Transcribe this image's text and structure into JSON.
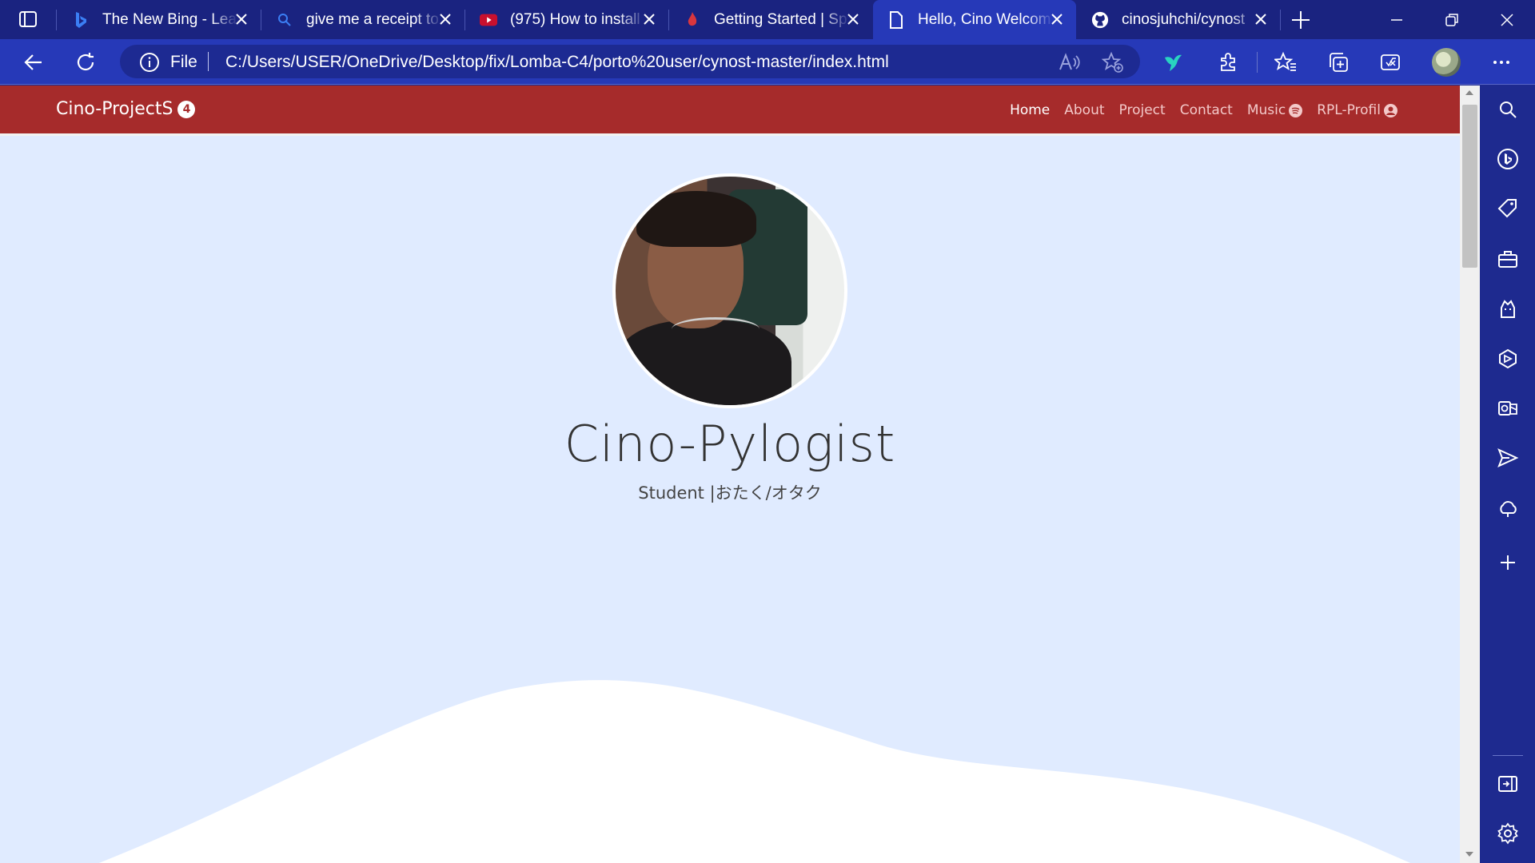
{
  "browser": {
    "tabs": [
      {
        "title": "The New Bing - Lear",
        "icon": "bing-icon",
        "active": false
      },
      {
        "title": "give me a receipt to",
        "icon": "search-icon",
        "active": false
      },
      {
        "title": "(975) How to install",
        "icon": "youtube-icon",
        "active": false
      },
      {
        "title": "Getting Started | Sp",
        "icon": "flame-icon",
        "active": false
      },
      {
        "title": "Hello, Cino Welcom",
        "icon": "document-icon",
        "active": true
      },
      {
        "title": "cinosjuhchi/cynost",
        "icon": "github-icon",
        "active": false
      }
    ],
    "address": {
      "scheme_label": "File",
      "url": "C:/Users/USER/OneDrive/Desktop/fix/Lomba-C4/porto%20user/cynost-master/index.html"
    },
    "accent": "#2639b8",
    "frame_color": "#1a2380"
  },
  "site": {
    "brand": "Cino-ProjectS",
    "badge": "4",
    "nav": [
      {
        "label": "Home",
        "active": true
      },
      {
        "label": "About"
      },
      {
        "label": "Project"
      },
      {
        "label": "Contact"
      },
      {
        "label": "Music",
        "icon": "spotify-icon"
      },
      {
        "label": "RPL-Profil",
        "icon": "user-circle-icon"
      }
    ],
    "name": "Cino-Pylogist",
    "tagline": "Student |おたく/オタク",
    "nav_color": "#a62b2b",
    "bg_color": "#e0ebff"
  },
  "sidebar_icons": [
    "search-icon",
    "copilot-icon",
    "shopping-tag-icon",
    "tools-icon",
    "games-icon",
    "microsoft-365-icon",
    "outlook-icon",
    "drop-send-icon",
    "cloud-icon",
    "add-icon",
    "hide-sidebar-icon",
    "settings-icon"
  ]
}
